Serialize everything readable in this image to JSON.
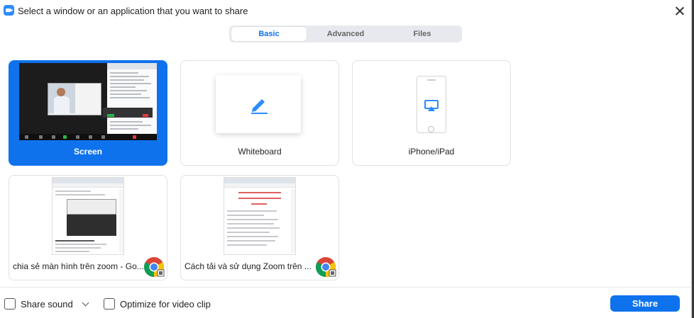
{
  "window": {
    "title": "Select a window or an application that you want to share",
    "app_icon": "zoom-icon",
    "close_icon": "close-icon"
  },
  "tabs": [
    {
      "label": "Basic",
      "active": true
    },
    {
      "label": "Advanced",
      "active": false
    },
    {
      "label": "Files",
      "active": false
    }
  ],
  "basic_options": [
    {
      "label": "Screen",
      "selected": true,
      "icon": "desktop-thumbnail"
    },
    {
      "label": "Whiteboard",
      "selected": false,
      "icon": "pencil-icon"
    },
    {
      "label": "iPhone/iPad",
      "selected": false,
      "icon": "airplay-icon"
    }
  ],
  "windows": [
    {
      "label": "chia sẻ màn hình trên zoom - Go...",
      "app_icon": "chrome-icon"
    },
    {
      "label": "Cách tải và sử dụng Zoom trên ...",
      "app_icon": "chrome-icon"
    }
  ],
  "footer": {
    "share_sound_label": "Share sound",
    "share_sound_checked": false,
    "optimize_label": "Optimize for video clip",
    "optimize_checked": false,
    "share_button_label": "Share"
  },
  "colors": {
    "accent": "#0e72ed",
    "tab_background": "#e8e9ee",
    "selected_tile": "#0e72ed"
  }
}
